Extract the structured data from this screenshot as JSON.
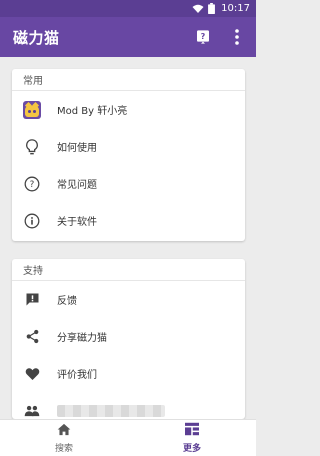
{
  "status_bar": {
    "time": "10:17",
    "icons": [
      "wifi-icon",
      "battery-icon"
    ]
  },
  "app_bar": {
    "title": "磁力猫",
    "actions": [
      "help-icon",
      "more-vert-icon"
    ]
  },
  "section_common": {
    "header": "常用",
    "items": [
      {
        "icon": "app-avatar",
        "label": "Mod By 轩小亮"
      },
      {
        "icon": "lightbulb-icon",
        "label": "如何使用"
      },
      {
        "icon": "help-circle-icon",
        "label": "常见问题"
      },
      {
        "icon": "info-icon",
        "label": "关于软件"
      }
    ]
  },
  "section_support": {
    "header": "支持",
    "items": [
      {
        "icon": "feedback-icon",
        "label": "反馈"
      },
      {
        "icon": "share-icon",
        "label": "分享磁力猫"
      },
      {
        "icon": "heart-icon",
        "label": "评价我们"
      },
      {
        "icon": "group-icon",
        "label": ""
      }
    ]
  },
  "bottom_nav": {
    "items": [
      {
        "icon": "home-icon",
        "label": "搜索",
        "active": false
      },
      {
        "icon": "dashboard-icon",
        "label": "更多",
        "active": true
      }
    ]
  },
  "colors": {
    "status_bar": "#5B3E93",
    "app_bar": "#6847A3",
    "accent": "#5B3E93",
    "background": "#ECECEC"
  }
}
